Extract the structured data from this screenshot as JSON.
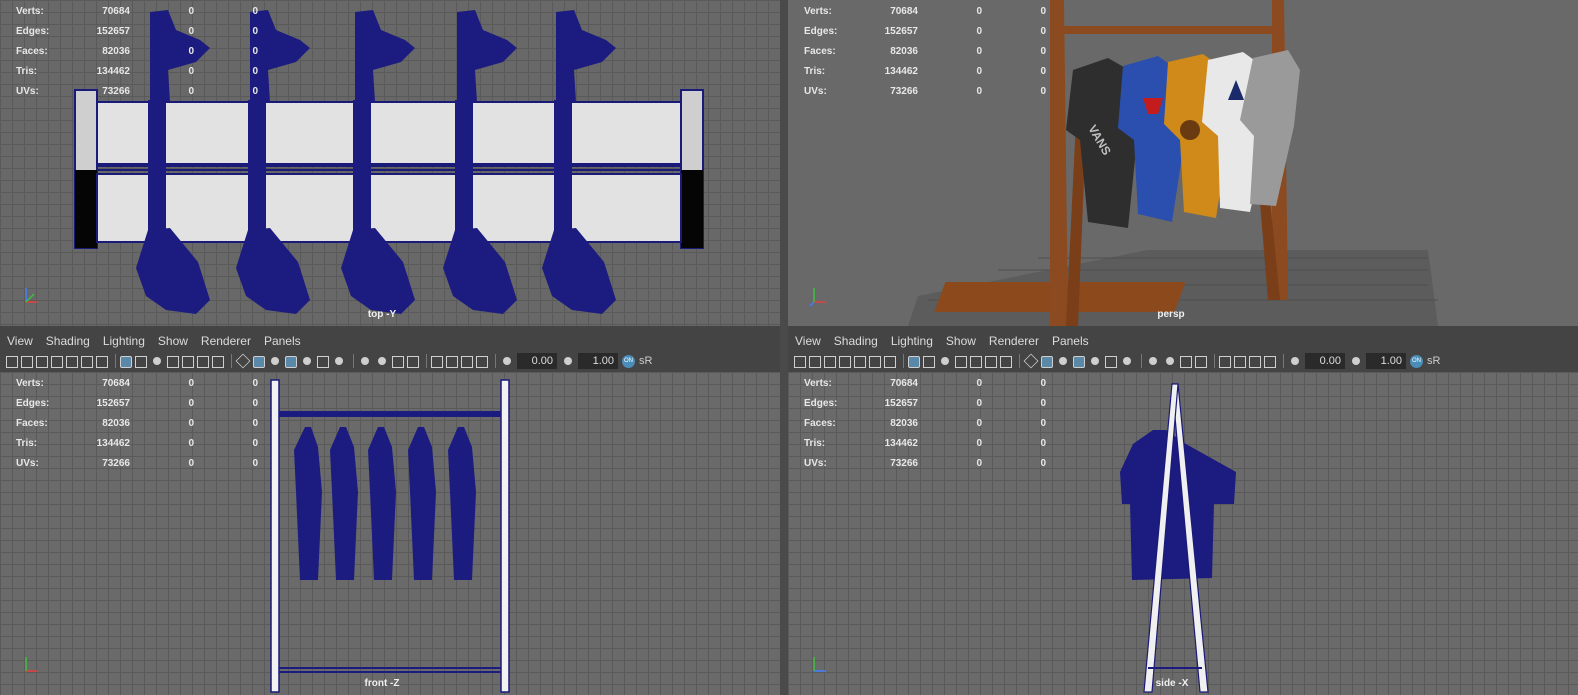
{
  "menu": [
    "View",
    "Shading",
    "Lighting",
    "Show",
    "Renderer",
    "Panels"
  ],
  "stats": {
    "rows": [
      {
        "label": "Verts:",
        "v1": "70684",
        "v2": "0",
        "v3": "0"
      },
      {
        "label": "Edges:",
        "v1": "152657",
        "v2": "0",
        "v3": "0"
      },
      {
        "label": "Faces:",
        "v1": "82036",
        "v2": "0",
        "v3": "0"
      },
      {
        "label": "Tris:",
        "v1": "134462",
        "v2": "0",
        "v3": "0"
      },
      {
        "label": "UVs:",
        "v1": "73266",
        "v2": "0",
        "v3": "0"
      }
    ]
  },
  "viewports": {
    "top": {
      "label": "top -Y"
    },
    "persp": {
      "label": "persp"
    },
    "front": {
      "label": "front -Z"
    },
    "side": {
      "label": "side -X"
    }
  },
  "toolbar": {
    "exposure": "0.00",
    "gamma": "1.00",
    "toggle": "ON",
    "colorspace": "sR"
  },
  "colors": {
    "wire": "#1a1a78",
    "wood": "#8a4a20",
    "grid": "#686868"
  }
}
